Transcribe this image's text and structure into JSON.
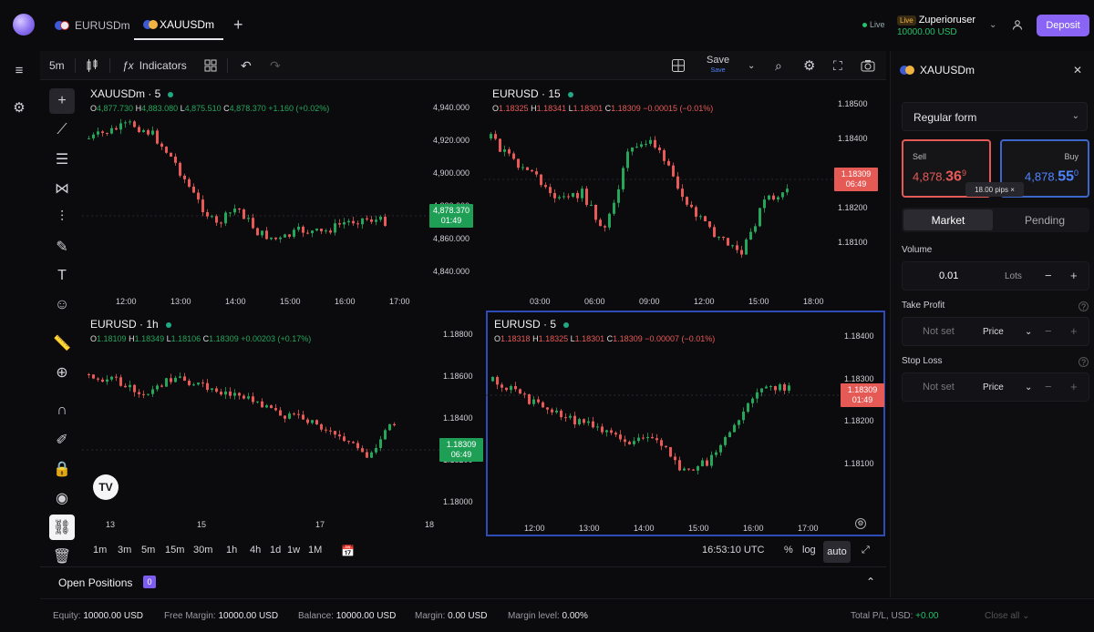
{
  "header": {
    "tabs": [
      {
        "label": "EURUSDm"
      },
      {
        "label": "XAUUSDm"
      }
    ],
    "live_label": "Live",
    "account_badge": "Live",
    "account_name": "Zuperioruser",
    "account_balance": "10000.00 USD",
    "deposit_label": "Deposit"
  },
  "toolbar": {
    "interval": "5m",
    "indicators_label": "Indicators",
    "save_label": "Save",
    "save_sub": "Save"
  },
  "panes": [
    {
      "title": "XAUUSDm · 5",
      "ohlc": {
        "o": "4,877.730",
        "h": "4,883.080",
        "l": "4,875.510",
        "c": "4,878.370",
        "chg": "+1.160 (+0.02%)",
        "dir": "up"
      },
      "price_labels": [
        "4,940.000",
        "4,920.000",
        "4,900.000",
        "4,880.000",
        "4,860.000",
        "4,840.000"
      ],
      "time_labels": [
        "12:00",
        "13:00",
        "14:00",
        "15:00",
        "16:00",
        "17:00"
      ],
      "last_price": "4,878.370",
      "countdown": "01:49",
      "tag_color": "green"
    },
    {
      "title": "EURUSD · 15",
      "ohlc": {
        "o": "1.18325",
        "h": "1.18341",
        "l": "1.18301",
        "c": "1.18309",
        "chg": "−0.00015 (−0.01%)",
        "dir": "down"
      },
      "price_labels": [
        "1.18500",
        "1.18400",
        "1.18300",
        "1.18200",
        "1.18100"
      ],
      "time_labels": [
        "03:00",
        "06:00",
        "09:00",
        "12:00",
        "15:00",
        "18:00"
      ],
      "last_price": "1.18309",
      "countdown": "06:49",
      "tag_color": "red"
    },
    {
      "title": "EURUSD · 1h",
      "ohlc": {
        "o": "1.18109",
        "h": "1.18349",
        "l": "1.18106",
        "c": "1.18309",
        "chg": "+0.00203 (+0.17%)",
        "dir": "up"
      },
      "price_labels": [
        "1.18800",
        "1.18600",
        "1.18400",
        "1.18200",
        "1.18000"
      ],
      "time_labels": [
        "13",
        "15",
        "17",
        "18"
      ],
      "last_price": "1.18309",
      "countdown": "06:49",
      "tag_color": "green"
    },
    {
      "title": "EURUSD · 5",
      "ohlc": {
        "o": "1.18318",
        "h": "1.18325",
        "l": "1.18301",
        "c": "1.18309",
        "chg": "−0.00007 (−0.01%)",
        "dir": "down"
      },
      "price_labels": [
        "1.18400",
        "1.18300",
        "1.18200",
        "1.18100"
      ],
      "time_labels": [
        "12:00",
        "13:00",
        "14:00",
        "15:00",
        "16:00",
        "17:00"
      ],
      "last_price": "1.18309",
      "countdown": "01:49",
      "tag_color": "red"
    }
  ],
  "timeframes": [
    "1m",
    "3m",
    "5m",
    "15m",
    "30m",
    "1h",
    "4h",
    "1d",
    "1w",
    "1M"
  ],
  "bottom_right": {
    "clock": "16:53:10 UTC",
    "percent": "%",
    "log": "log",
    "auto": "auto"
  },
  "open_positions": {
    "label": "Open Positions",
    "count": "0"
  },
  "status": {
    "equity_label": "Equity:",
    "equity": "10000.00 USD",
    "free_margin_label": "Free Margin:",
    "free_margin": "10000.00 USD",
    "balance_label": "Balance:",
    "balance": "10000.00 USD",
    "margin_label": "Margin:",
    "margin": "0.00 USD",
    "margin_level_label": "Margin level:",
    "margin_level": "0.00%",
    "total_pl_label": "Total P/L, USD:",
    "total_pl": "+0.00",
    "close_all": "Close all"
  },
  "order_panel": {
    "symbol": "XAUUSDm",
    "form": "Regular form",
    "sell_label": "Sell",
    "sell_price_main": "4,878.",
    "sell_price_big": "36",
    "sell_price_sup": "9",
    "buy_label": "Buy",
    "buy_price_main": "4,878.",
    "buy_price_big": "55",
    "buy_price_sup": "0",
    "spread": "18.00 pips",
    "market_tab": "Market",
    "pending_tab": "Pending",
    "volume_label": "Volume",
    "volume_value": "0.01",
    "volume_unit": "Lots",
    "tp_label": "Take Profit",
    "tp_value": "Not set",
    "tp_type": "Price",
    "sl_label": "Stop Loss",
    "sl_value": "Not set",
    "sl_type": "Price"
  },
  "colors": {
    "up": "#26a65b",
    "down": "#e85a58",
    "accent": "#8a65f5",
    "active_pane": "#2f4bb8"
  }
}
